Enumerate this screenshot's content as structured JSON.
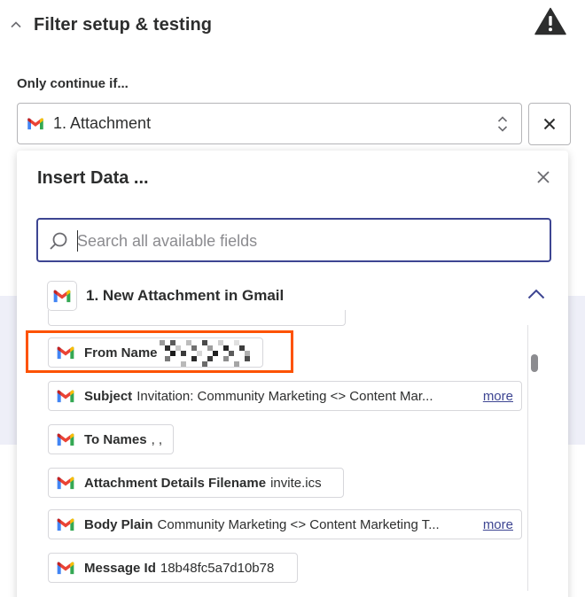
{
  "section": {
    "title": "Filter setup & testing"
  },
  "filter": {
    "label": "Only continue if...",
    "selected_value": "1. Attachment"
  },
  "insert_panel": {
    "title": "Insert Data ...",
    "search": {
      "placeholder": "Search all available fields",
      "value": ""
    },
    "group": {
      "title": "1. New Attachment in Gmail"
    },
    "rows": [
      {
        "label": "From Name",
        "value": ""
      },
      {
        "label": "Subject",
        "value": "Invitation: Community Marketing <> Content Mar...",
        "more": "more"
      },
      {
        "label": "To Names",
        "value": ", ,"
      },
      {
        "label": "Attachment Details Filename",
        "value": "invite.ics"
      },
      {
        "label": "Body Plain",
        "value": "Community Marketing <> Content Marketing T...",
        "more": "more"
      },
      {
        "label": "Message Id",
        "value": "18b48fc5a7d10b78"
      }
    ]
  },
  "colors": {
    "accent": "#3d4592",
    "highlight": "#fd5200",
    "text": "#2d2e2e"
  },
  "icons": [
    "chevron-up-icon",
    "warning-icon",
    "gmail-icon",
    "updown-chevron-icon",
    "close-icon",
    "search-icon",
    "chevron-up-icon"
  ]
}
